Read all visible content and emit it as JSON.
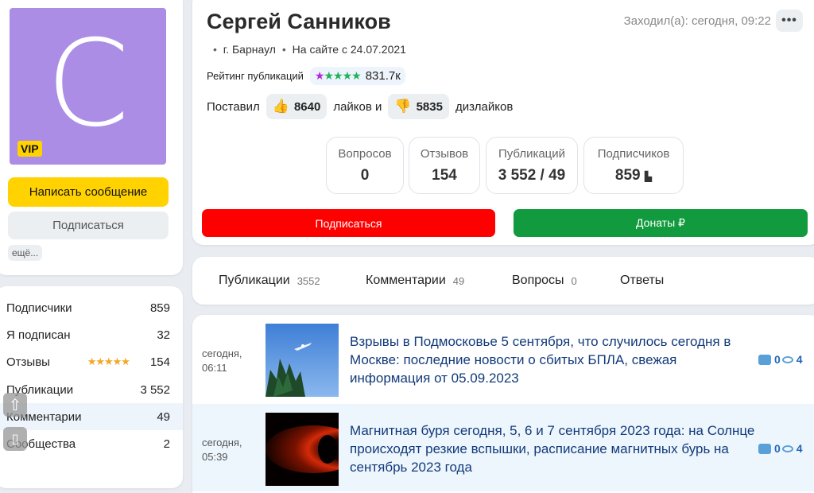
{
  "profile": {
    "avatar_letter": "С",
    "vip_label": "VIP",
    "name": "Сергей Санников",
    "last_seen": "Заходил(а): сегодня, 09:22",
    "more_dots": "•••",
    "city": "г. Барнаул",
    "member_since": "На сайте с 24.07.2021",
    "rating_label": "Рейтинг публикаций",
    "rating_value": "831.7к",
    "votes_prefix": "Поставил",
    "likes": "8640",
    "likes_suffix": "лайков и",
    "dislikes": "5835",
    "dislikes_suffix": "дизлайков"
  },
  "left_actions": {
    "write_message": "Написать сообщение",
    "subscribe": "Подписаться",
    "more": "ещё..."
  },
  "counters": [
    {
      "label": "Вопросов",
      "value": "0"
    },
    {
      "label": "Отзывов",
      "value": "154"
    },
    {
      "label": "Публикаций",
      "value": "3 552 / 49"
    },
    {
      "label": "Подписчиков",
      "value": "859"
    }
  ],
  "main_actions": {
    "subscribe": "Подписаться",
    "donate": "Донаты ₽"
  },
  "stats": [
    {
      "label": "Подписчики",
      "value": "859"
    },
    {
      "label": "Я подписан",
      "value": "32"
    },
    {
      "label": "Отзывы",
      "value": "154",
      "stars": "★★★★★"
    },
    {
      "label": "Публикации",
      "value": "3 552"
    },
    {
      "label": "Комментарии",
      "value": "49"
    },
    {
      "label": "Сообщества",
      "value": "2"
    }
  ],
  "tabs": [
    {
      "label": "Публикации",
      "count": "3552"
    },
    {
      "label": "Комментарии",
      "count": "49"
    },
    {
      "label": "Вопросы",
      "count": "0"
    },
    {
      "label": "Ответы",
      "count": ""
    }
  ],
  "posts": [
    {
      "time_day": "сегодня,",
      "time_clock": "06:11",
      "title": "Взрывы в Подмосковье 5 сентября, что случилось сегодня в Москве: последние новости о сбитых БПЛА, свежая информация от 05.09.2023",
      "comments": "0",
      "views": "4"
    },
    {
      "time_day": "сегодня,",
      "time_clock": "05:39",
      "title": "Магнитная буря сегодня, 5, 6 и 7 сентября 2023 года: на Солнце происходят резкие вспышки, расписание магнитных бурь на сентябрь 2023 года",
      "comments": "0",
      "views": "4"
    }
  ],
  "colors": {
    "avatar_bg": "#ab8de6",
    "accent_yellow": "#ffd200",
    "subscribe_red": "#ff0000",
    "donate_green": "#119a3e",
    "link_blue": "#123a7a"
  }
}
